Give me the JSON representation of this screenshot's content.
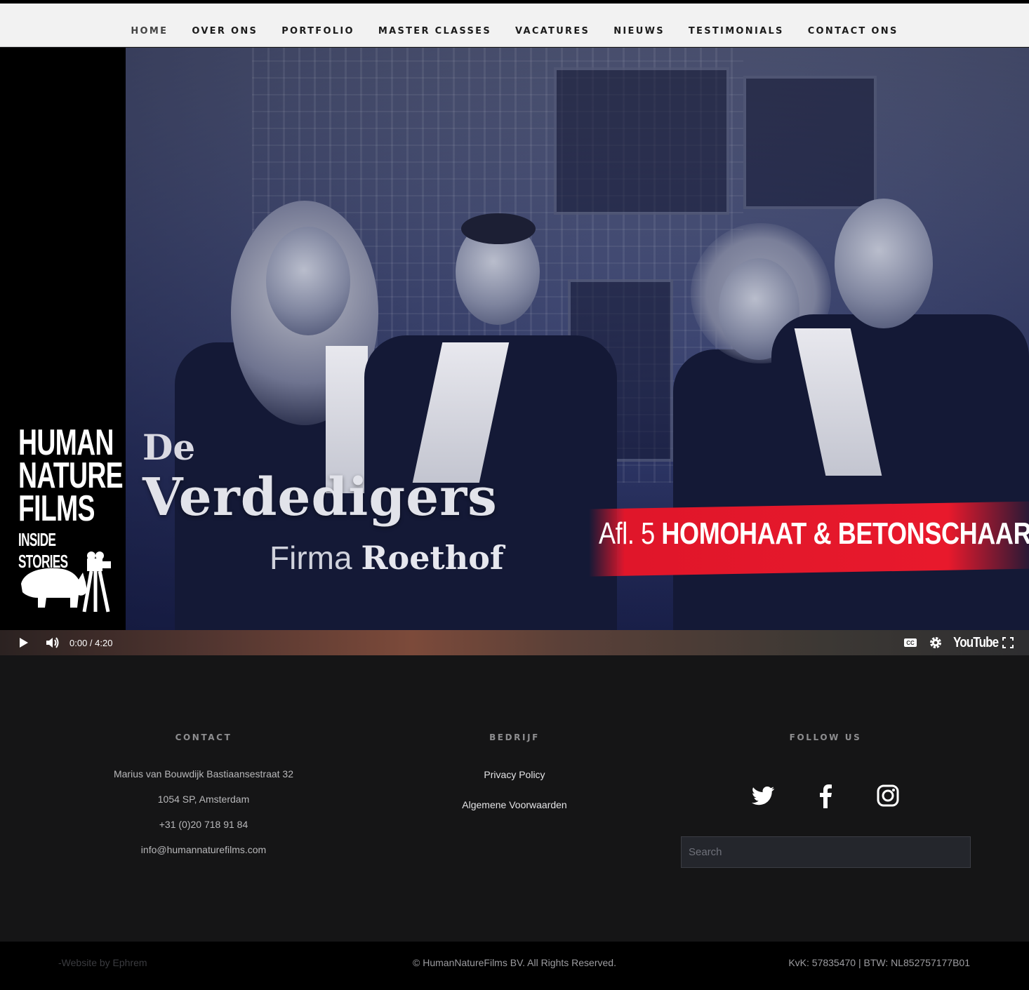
{
  "nav": {
    "items": [
      {
        "label": "HOME"
      },
      {
        "label": "OVER ONS"
      },
      {
        "label": "PORTFOLIO"
      },
      {
        "label": "MASTER CLASSES"
      },
      {
        "label": "VACATURES"
      },
      {
        "label": "NIEUWS"
      },
      {
        "label": "TESTIMONIALS"
      },
      {
        "label": "CONTACT ONS"
      }
    ]
  },
  "video": {
    "logo_lines": [
      "HUMAN",
      "NATURE",
      "FILMS"
    ],
    "logo_tagline": "INSIDE STORIES",
    "show_de": "De",
    "show_title": "Verdedigers",
    "show_sub_firm": "Firma",
    "show_sub_name": "Roethof",
    "episode_num": "Afl. 5",
    "episode_title": "HOMOHAAT & BETONSCHAAR",
    "time": "0:00 / 4:20",
    "platform": "YouTube"
  },
  "footer": {
    "contact": {
      "heading": "CONTACT",
      "lines": [
        "Marius van Bouwdijk Bastiaansestraat 32",
        "1054 SP, Amsterdam",
        "+31 (0)20 718 91 84",
        "info@humannaturefilms.com"
      ]
    },
    "company": {
      "heading": "BEDRIJF",
      "links": [
        "Privacy Policy",
        "Algemene Voorwaarden"
      ]
    },
    "follow": {
      "heading": "FOLLOW US",
      "icons": [
        "twitter-icon",
        "facebook-icon",
        "instagram-icon"
      ],
      "search_placeholder": "Search"
    }
  },
  "bottom": {
    "credit": "-Website by Ephrem",
    "copyright": "© HumanNatureFilms BV. All Rights Reserved.",
    "registration": "KvK: 57835470  |  BTW: NL852757177B01"
  }
}
